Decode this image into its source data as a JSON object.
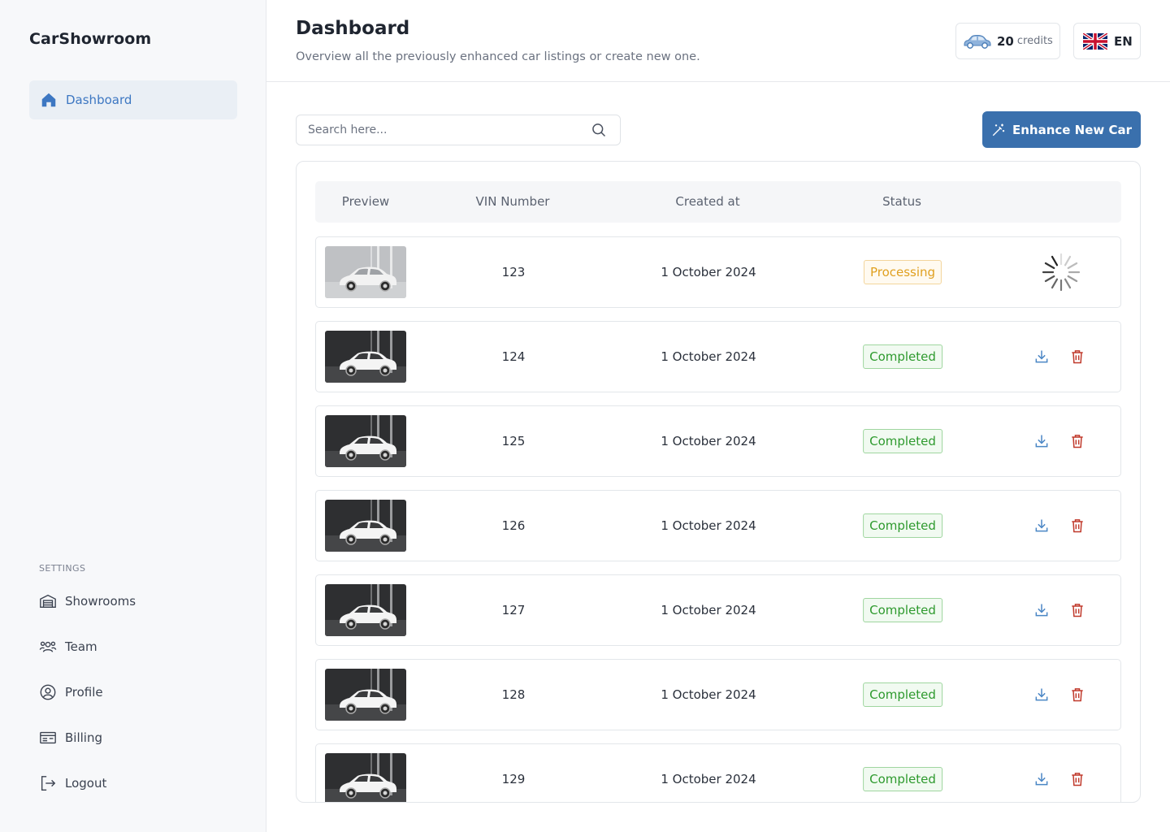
{
  "app": {
    "brand": "CarShowroom"
  },
  "sidebar": {
    "active_item": {
      "label": "Dashboard",
      "icon": "home-icon"
    },
    "settings_title": "SETTINGS",
    "items": [
      {
        "label": "Showrooms",
        "icon": "garage-icon"
      },
      {
        "label": "Team",
        "icon": "team-icon"
      },
      {
        "label": "Profile",
        "icon": "profile-icon"
      },
      {
        "label": "Billing",
        "icon": "billing-icon"
      },
      {
        "label": "Logout",
        "icon": "logout-icon"
      }
    ]
  },
  "header": {
    "title": "Dashboard",
    "subtitle": "Overview all the previously enhanced car listings or create new one.",
    "credits": {
      "count": "20",
      "unit": "credits"
    },
    "language": {
      "code": "EN"
    }
  },
  "toolbar": {
    "search_placeholder": "Search here...",
    "enhance_label": "Enhance New Car"
  },
  "table": {
    "columns": [
      "Preview",
      "VIN Number",
      "Created at",
      "Status"
    ],
    "rows": [
      {
        "vin": "123",
        "created": "1 October 2024",
        "status": "Processing"
      },
      {
        "vin": "124",
        "created": "1 October 2024",
        "status": "Completed"
      },
      {
        "vin": "125",
        "created": "1 October 2024",
        "status": "Completed"
      },
      {
        "vin": "126",
        "created": "1 October 2024",
        "status": "Completed"
      },
      {
        "vin": "127",
        "created": "1 October 2024",
        "status": "Completed"
      },
      {
        "vin": "128",
        "created": "1 October 2024",
        "status": "Completed"
      },
      {
        "vin": "129",
        "created": "1 October 2024",
        "status": "Completed"
      }
    ]
  },
  "colors": {
    "accent": "#3a70ad",
    "active_nav_text": "#3d77c2",
    "completed": "#2e9a2e",
    "processing": "#e0a020",
    "delete": "#c0392b",
    "download": "#4a86c5"
  }
}
